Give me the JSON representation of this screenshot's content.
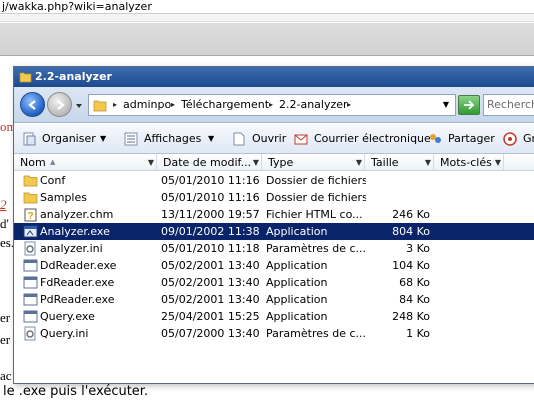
{
  "browser": {
    "url_fragment": "j/wakka.php?wiki=analyzer",
    "page_fragments": [
      "2",
      "om",
      "d'",
      "es.",
      "er",
      "er",
      "ac"
    ],
    "footer_text": "le .exe puis l'exécuter."
  },
  "window": {
    "title": "2.2-analyzer"
  },
  "address": {
    "crumbs": [
      "adminpo",
      "Téléchargement",
      "2.2-analyzer"
    ],
    "search_placeholder": "Rechercher"
  },
  "commands": {
    "organize": "Organiser",
    "views": "Affichages",
    "open": "Ouvrir",
    "email": "Courrier électronique",
    "share": "Partager",
    "burn": "Gr"
  },
  "columns": {
    "name": "Nom",
    "date": "Date de modif...",
    "type": "Type",
    "size": "Taille",
    "tags": "Mots-clés"
  },
  "files": [
    {
      "name": "Conf",
      "date": "05/01/2010 11:16",
      "type": "Dossier de fichiers",
      "size": "",
      "icon": "folder-icon"
    },
    {
      "name": "Samples",
      "date": "05/01/2010 11:16",
      "type": "Dossier de fichiers",
      "size": "",
      "icon": "folder-icon"
    },
    {
      "name": "analyzer.chm",
      "date": "13/11/2000 19:57",
      "type": "Fichier HTML co...",
      "size": "246 Ko",
      "icon": "help-file-icon"
    },
    {
      "name": "Analyzer.exe",
      "date": "09/01/2002 11:38",
      "type": "Application",
      "size": "804 Ko",
      "icon": "exe-icon",
      "selected": true
    },
    {
      "name": "analyzer.ini",
      "date": "05/01/2010 11:18",
      "type": "Paramètres de c...",
      "size": "3 Ko",
      "icon": "settings-file-icon"
    },
    {
      "name": "DdReader.exe",
      "date": "05/02/2001 13:40",
      "type": "Application",
      "size": "104 Ko",
      "icon": "exe-icon"
    },
    {
      "name": "FdReader.exe",
      "date": "05/02/2001 13:40",
      "type": "Application",
      "size": "68 Ko",
      "icon": "exe-icon"
    },
    {
      "name": "PdReader.exe",
      "date": "05/02/2001 13:40",
      "type": "Application",
      "size": "84 Ko",
      "icon": "exe-icon"
    },
    {
      "name": "Query.exe",
      "date": "25/04/2001 15:25",
      "type": "Application",
      "size": "248 Ko",
      "icon": "exe-icon"
    },
    {
      "name": "Query.ini",
      "date": "05/07/2000 13:40",
      "type": "Paramètres de c...",
      "size": "1 Ko",
      "icon": "settings-file-icon"
    }
  ],
  "colors": {
    "selection": "#0a246a",
    "titlebar": "#1d4a8e",
    "folder": "#f2c94c"
  }
}
